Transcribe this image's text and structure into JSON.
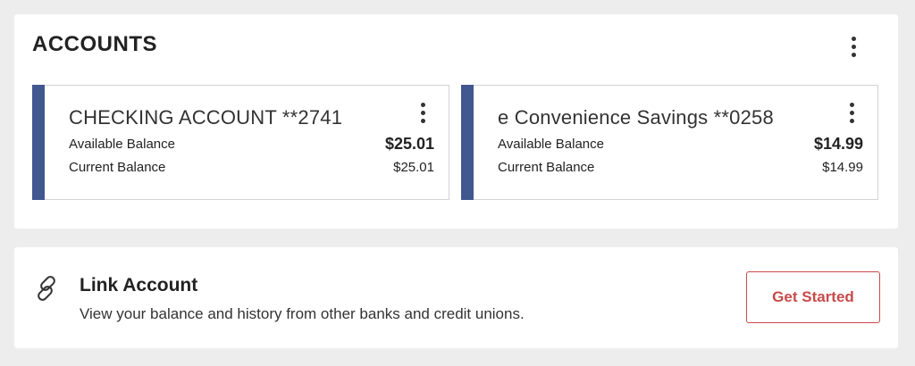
{
  "accounts_section": {
    "title": "ACCOUNTS",
    "menu_icon": "more-vertical-icon"
  },
  "accounts": [
    {
      "name": "CHECKING ACCOUNT **2741",
      "available_label": "Available Balance",
      "available_value": "$25.01",
      "current_label": "Current Balance",
      "current_value": "$25.01",
      "accent_color": "#41578f",
      "menu_icon": "more-vertical-icon"
    },
    {
      "name": "e Convenience Savings **0258",
      "available_label": "Available Balance",
      "available_value": "$14.99",
      "current_label": "Current Balance",
      "current_value": "$14.99",
      "accent_color": "#41578f",
      "menu_icon": "more-vertical-icon"
    }
  ],
  "link_account": {
    "icon": "link-icon",
    "title": "Link Account",
    "description": "View your balance and history from other banks and credit unions.",
    "button_label": "Get Started",
    "button_color": "#c94a4a"
  }
}
